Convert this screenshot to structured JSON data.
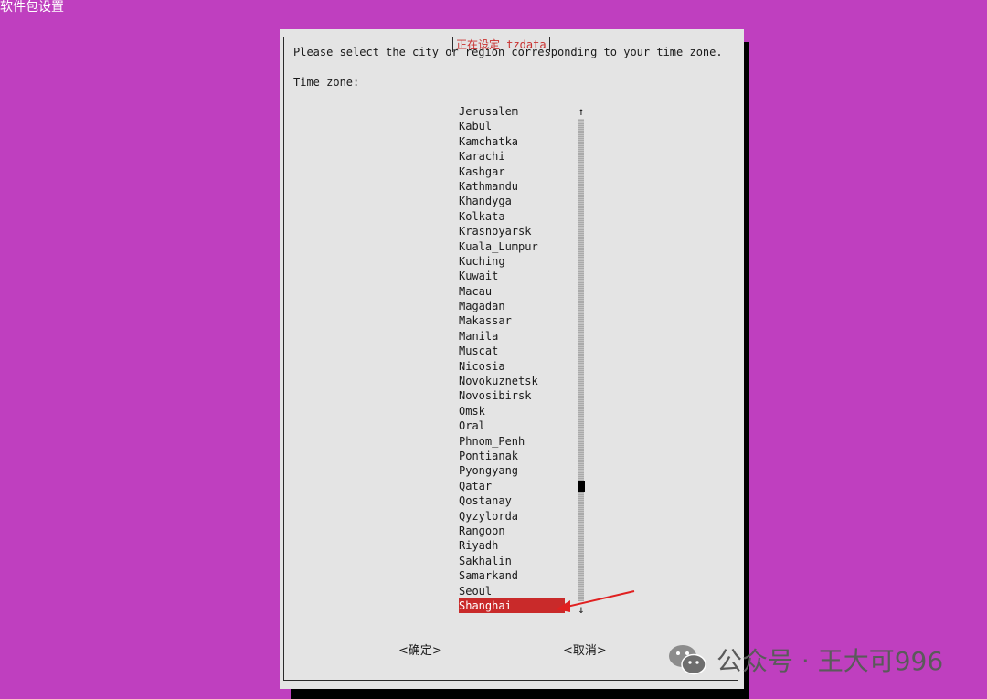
{
  "background_title": "软件包设置",
  "dialog": {
    "title": "正在设定 tzdata",
    "prompt": "Please select the city or region corresponding to your time zone.",
    "field_label": "Time zone:"
  },
  "time_zones": [
    "Jerusalem",
    "Kabul",
    "Kamchatka",
    "Karachi",
    "Kashgar",
    "Kathmandu",
    "Khandyga",
    "Kolkata",
    "Krasnoyarsk",
    "Kuala_Lumpur",
    "Kuching",
    "Kuwait",
    "Macau",
    "Magadan",
    "Makassar",
    "Manila",
    "Muscat",
    "Nicosia",
    "Novokuznetsk",
    "Novosibirsk",
    "Omsk",
    "Oral",
    "Phnom_Penh",
    "Pontianak",
    "Pyongyang",
    "Qatar",
    "Qostanay",
    "Qyzylorda",
    "Rangoon",
    "Riyadh",
    "Sakhalin",
    "Samarkand",
    "Seoul",
    "Shanghai"
  ],
  "selected_zone": "Shanghai",
  "scrollbar": {
    "up_arrow": "↑",
    "down_arrow": "↓"
  },
  "buttons": {
    "ok": "<确定>",
    "cancel": "<取消>"
  },
  "watermark": {
    "text": "公众号 · 王大可996"
  },
  "colors": {
    "desktop_bg": "#bf3fbf",
    "dialog_bg": "#e4e4e4",
    "title_text": "#c8302e",
    "selection_bg": "#c92a2a",
    "annotation_arrow": "#e02020"
  }
}
